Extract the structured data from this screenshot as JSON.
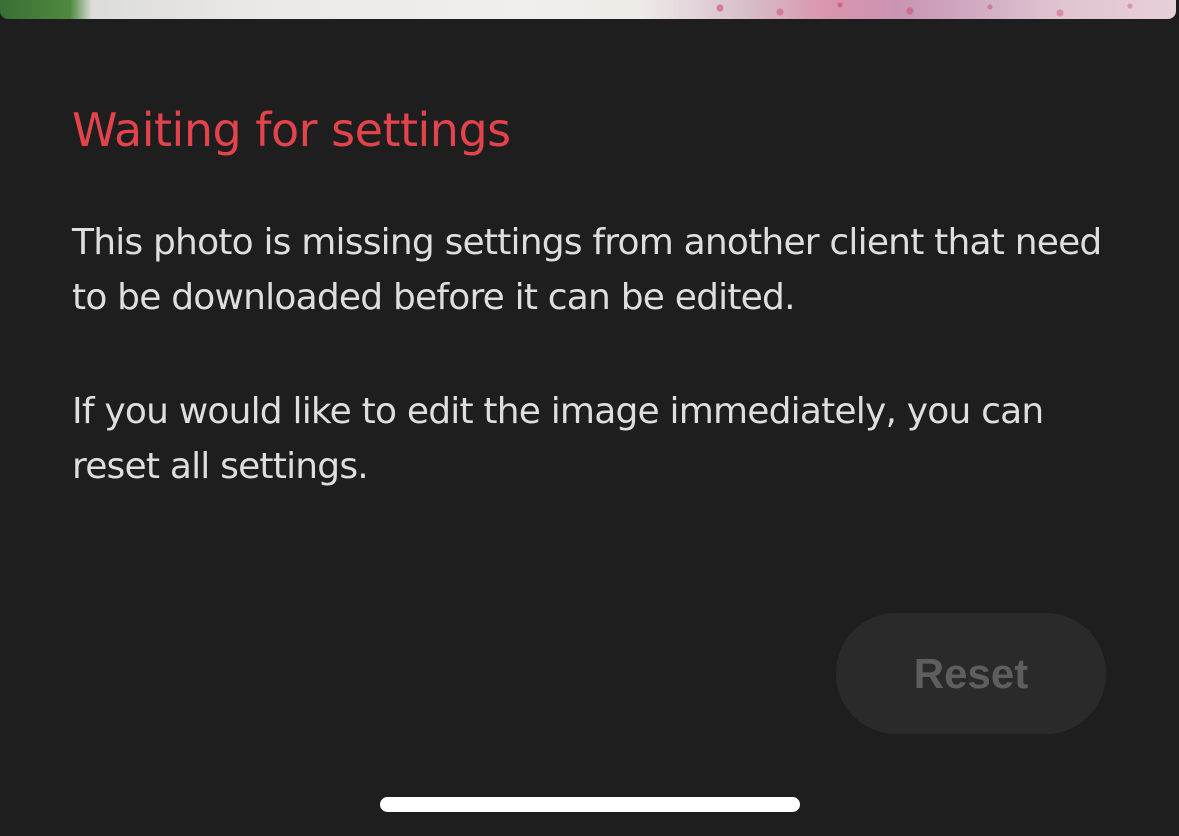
{
  "dialog": {
    "title": "Waiting for settings",
    "message_1": "This photo is missing settings from another client that need to be downloaded before it can be edited.",
    "message_2": "If you would like to edit the image immediately, you can reset all settings.",
    "reset_label": "Reset"
  },
  "colors": {
    "background": "#1e1e1f",
    "title": "#e3434b",
    "body_text": "#dedede",
    "button_bg": "#2a2a2b",
    "button_text_disabled": "#5e5e5f",
    "home_indicator": "#ffffff"
  },
  "icons": {
    "home_indicator": "home-indicator-bar"
  }
}
